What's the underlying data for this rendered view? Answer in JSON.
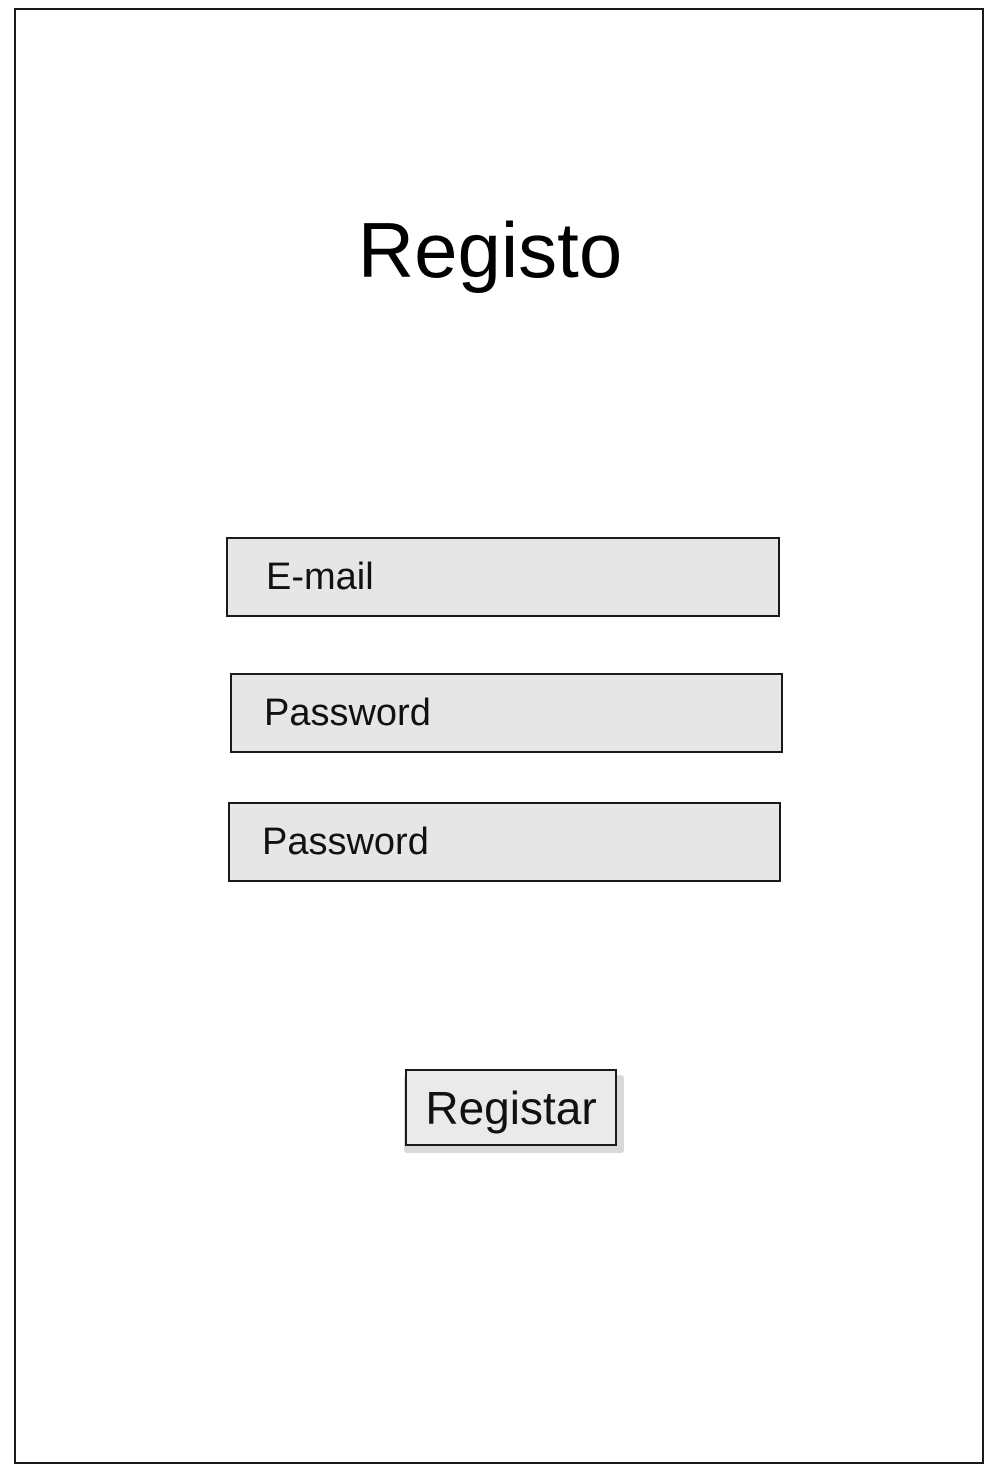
{
  "page": {
    "title": "Registo"
  },
  "form": {
    "email_placeholder": "E-mail",
    "password_placeholder": "Password",
    "confirm_password_placeholder": "Password",
    "submit_label": "Registar"
  },
  "colors": {
    "field_background": "#e6e6e6",
    "border": "#1a1a1a",
    "page_background": "#ffffff"
  }
}
